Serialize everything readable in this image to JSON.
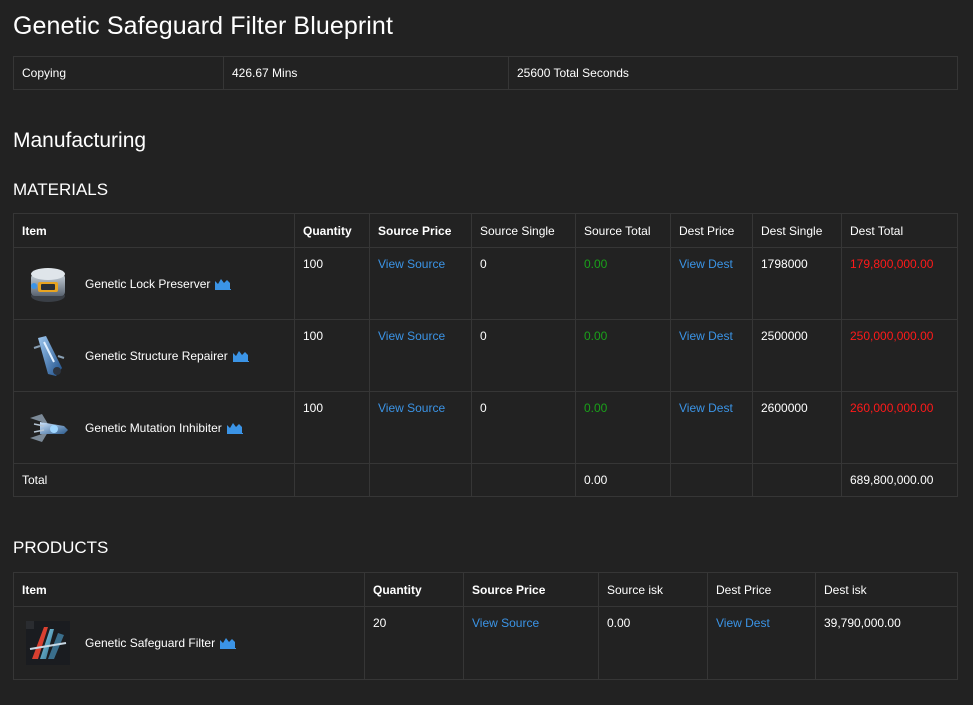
{
  "title": "Genetic Safeguard Filter Blueprint",
  "copying": {
    "label": "Copying",
    "mins": "426.67 Mins",
    "seconds": "25600 Total Seconds"
  },
  "manufacturing_heading": "Manufacturing",
  "materials": {
    "heading": "MATERIALS",
    "headers": [
      "Item",
      "Quantity",
      "Source Price",
      "Source Single",
      "Source Total",
      "Dest Price",
      "Dest Single",
      "Dest Total"
    ],
    "rows": [
      {
        "name": "Genetic Lock Preserver",
        "icon": "lock-preserver-icon",
        "quantity": "100",
        "source_price": "View Source",
        "source_single": "0",
        "source_total": "0.00",
        "dest_price": "View Dest",
        "dest_single": "1798000",
        "dest_total": "179,800,000.00"
      },
      {
        "name": "Genetic Structure Repairer",
        "icon": "structure-repairer-icon",
        "quantity": "100",
        "source_price": "View Source",
        "source_single": "0",
        "source_total": "0.00",
        "dest_price": "View Dest",
        "dest_single": "2500000",
        "dest_total": "250,000,000.00"
      },
      {
        "name": "Genetic Mutation Inhibiter",
        "icon": "mutation-inhibiter-icon",
        "quantity": "100",
        "source_price": "View Source",
        "source_single": "0",
        "source_total": "0.00",
        "dest_price": "View Dest",
        "dest_single": "2600000",
        "dest_total": "260,000,000.00"
      }
    ],
    "total": {
      "label": "Total",
      "source_total": "0.00",
      "dest_total": "689,800,000.00"
    }
  },
  "products": {
    "heading": "PRODUCTS",
    "headers": [
      "Item",
      "Quantity",
      "Source Price",
      "Source isk",
      "Dest Price",
      "Dest isk"
    ],
    "rows": [
      {
        "name": "Genetic Safeguard Filter",
        "icon": "safeguard-filter-icon",
        "quantity": "20",
        "source_price": "View Source",
        "source_isk": "0.00",
        "dest_price": "View Dest",
        "dest_isk": "39,790,000.00"
      }
    ]
  },
  "colors": {
    "background": "#222222",
    "link": "#3b94e6",
    "positive": "#1aa11a",
    "negative": "#ff1a1a",
    "border": "#363636"
  }
}
